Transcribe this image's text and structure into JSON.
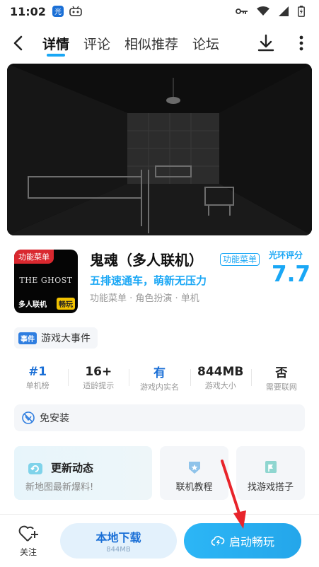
{
  "status_bar": {
    "time": "11:02"
  },
  "nav": {
    "tabs": [
      {
        "label": "详情",
        "active": true
      },
      {
        "label": "评论",
        "active": false
      },
      {
        "label": "相似推荐",
        "active": false
      },
      {
        "label": "论坛",
        "active": false
      }
    ]
  },
  "app": {
    "name": "鬼魂（多人联机）",
    "tag": "功能菜单",
    "slogan": "五排速通车，萌新无压力",
    "genres": "功能菜单 · 角色扮演 · 单机",
    "score_label": "光环评分",
    "score": "7.7",
    "icon": {
      "ribbon": "功能菜单",
      "title": "THE GHOST",
      "subtitle": "多人联机",
      "badge": "畅玩"
    }
  },
  "event": {
    "tag": "事件",
    "label": "游戏大事件"
  },
  "stats": [
    {
      "value": "#1",
      "label": "单机榜",
      "highlight": true
    },
    {
      "value": "16+",
      "label": "适龄提示",
      "highlight": false
    },
    {
      "value": "有",
      "label": "游戏内实名",
      "highlight": true
    },
    {
      "value": "844MB",
      "label": "游戏大小",
      "highlight": false
    },
    {
      "value": "否",
      "label": "需要联网",
      "highlight": false
    }
  ],
  "install": {
    "label": "免安装"
  },
  "cards": {
    "update": {
      "title": "更新动态",
      "subtitle": "新地图最新爆料!"
    },
    "tutorial": {
      "label": "联机教程"
    },
    "buddy": {
      "label": "找游戏搭子"
    }
  },
  "bottom": {
    "follow_label": "关注",
    "local_download": {
      "title": "本地下载",
      "size": "844MB"
    },
    "launch": {
      "label": "启动畅玩"
    }
  },
  "colors": {
    "accent": "#1aa7f5",
    "blue_dark": "#1a6fd6",
    "annotation": "#e8242b"
  }
}
